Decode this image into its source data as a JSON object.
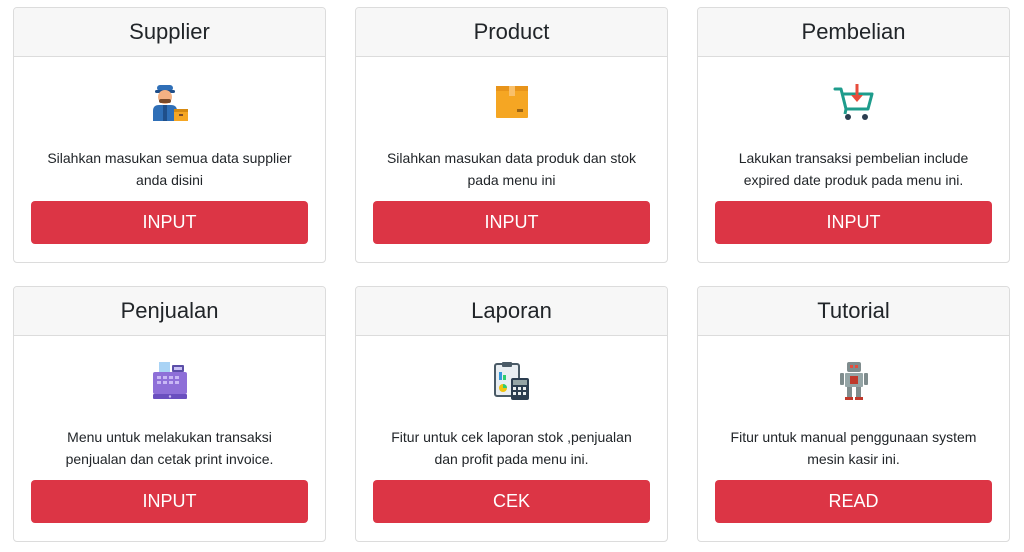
{
  "colors": {
    "button": "#dc3545",
    "header_bg": "#f7f7f7",
    "border": "#dcdcdc"
  },
  "cards": [
    {
      "title": "Supplier",
      "icon": "supplier-worker-icon",
      "description": "Silahkan masukan semua data supplier anda disini",
      "button_label": "INPUT"
    },
    {
      "title": "Product",
      "icon": "product-box-icon",
      "description": "Silahkan masukan data produk dan stok pada menu ini",
      "button_label": "INPUT"
    },
    {
      "title": "Pembelian",
      "icon": "shopping-cart-icon",
      "description": "Lakukan transaksi pembelian include expired date produk pada menu ini.",
      "button_label": "INPUT"
    },
    {
      "title": "Penjualan",
      "icon": "cash-register-icon",
      "description": "Menu untuk melakukan transaksi penjualan dan cetak print invoice.",
      "button_label": "INPUT"
    },
    {
      "title": "Laporan",
      "icon": "report-calculator-icon",
      "description": "Fitur untuk cek laporan stok ,penjualan dan profit pada menu ini.",
      "button_label": "CEK"
    },
    {
      "title": "Tutorial",
      "icon": "robot-icon",
      "description": "Fitur untuk manual penggunaan system mesin kasir ini.",
      "button_label": "READ"
    }
  ]
}
